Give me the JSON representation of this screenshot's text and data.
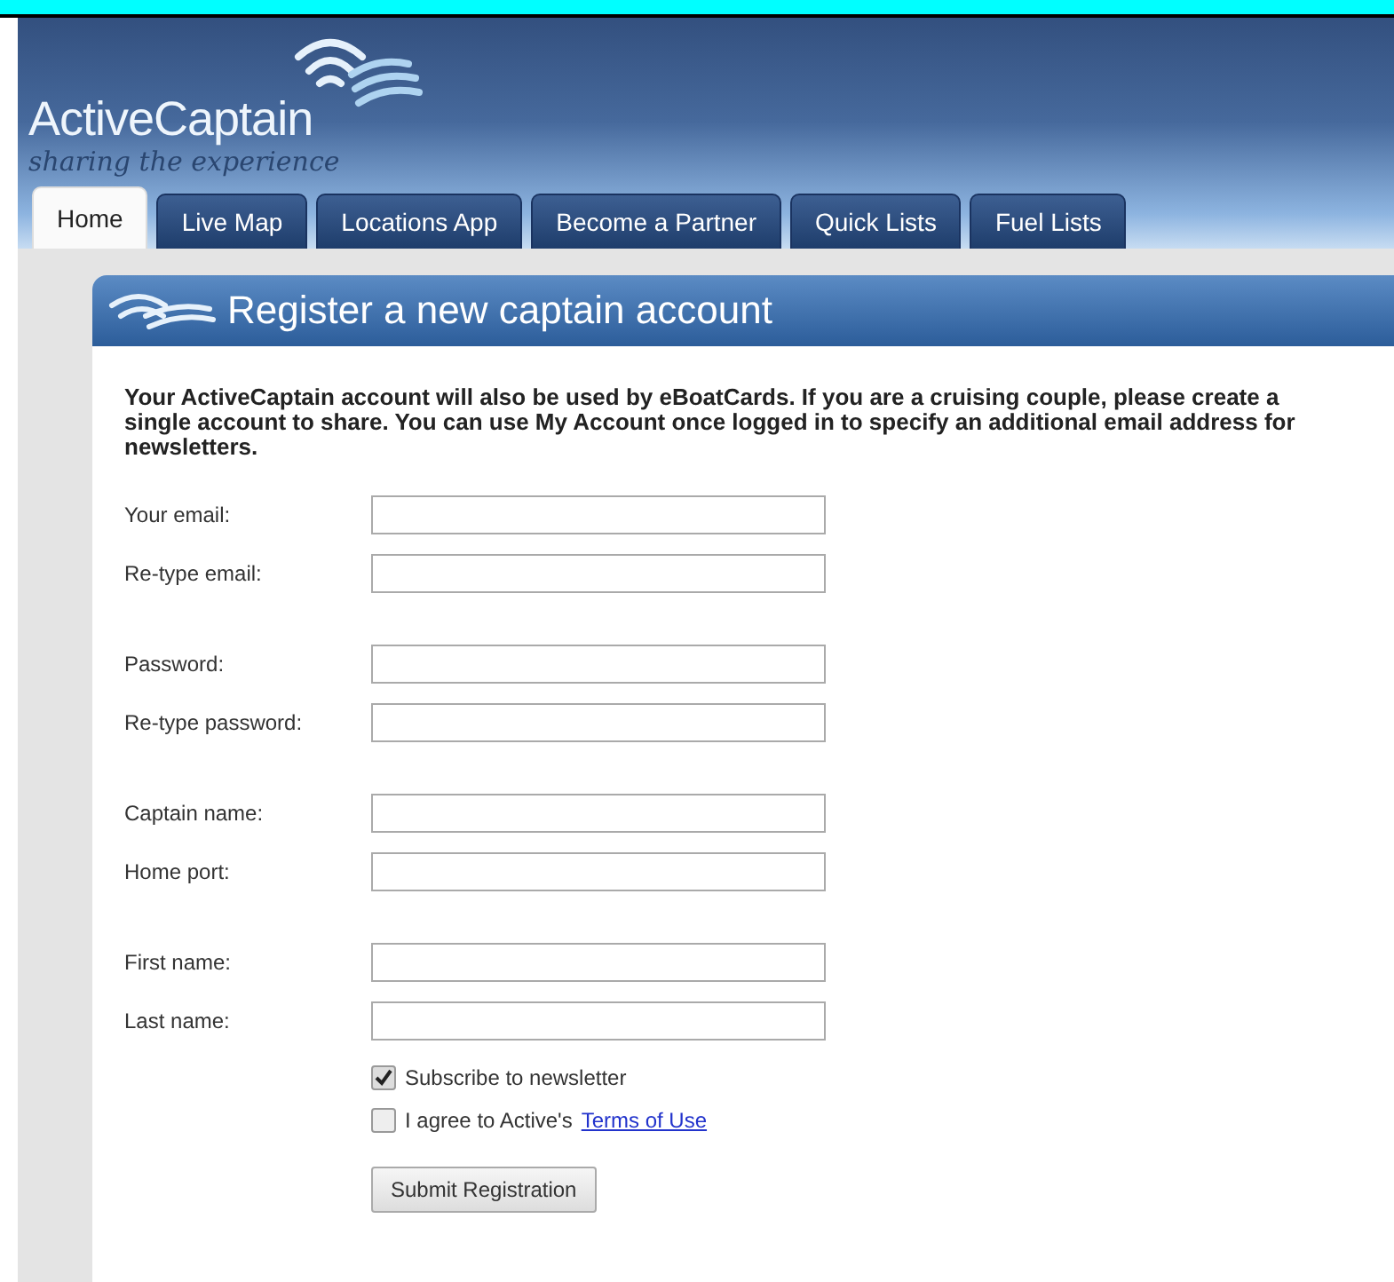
{
  "header": {
    "logo": "ActiveCaptain",
    "tagline": "sharing the experience"
  },
  "tabs": [
    {
      "label": "Home",
      "selected": true
    },
    {
      "label": "Live Map",
      "selected": false
    },
    {
      "label": "Locations App",
      "selected": false
    },
    {
      "label": "Become a Partner",
      "selected": false
    },
    {
      "label": "Quick Lists",
      "selected": false
    },
    {
      "label": "Fuel Lists",
      "selected": false
    }
  ],
  "panel": {
    "title": "Register a new captain account",
    "intro": "Your ActiveCaptain account will also be used by eBoatCards. If you are a cruising couple, please create a single account to share. You can use My Account once logged in to specify an additional email address for newsletters.",
    "field_groups": [
      [
        {
          "label": "Your email:"
        },
        {
          "label": "Re-type email:"
        }
      ],
      [
        {
          "label": "Password:"
        },
        {
          "label": "Re-type password:"
        }
      ],
      [
        {
          "label": "Captain name:"
        },
        {
          "label": "Home port:"
        }
      ],
      [
        {
          "label": "First name:"
        },
        {
          "label": "Last name:"
        }
      ]
    ],
    "checkboxes": [
      {
        "label": "Subscribe to newsletter",
        "checked": true
      },
      {
        "label": "I agree to Active's",
        "link": "Terms of Use",
        "checked": false
      }
    ],
    "submit": "Submit Registration"
  }
}
